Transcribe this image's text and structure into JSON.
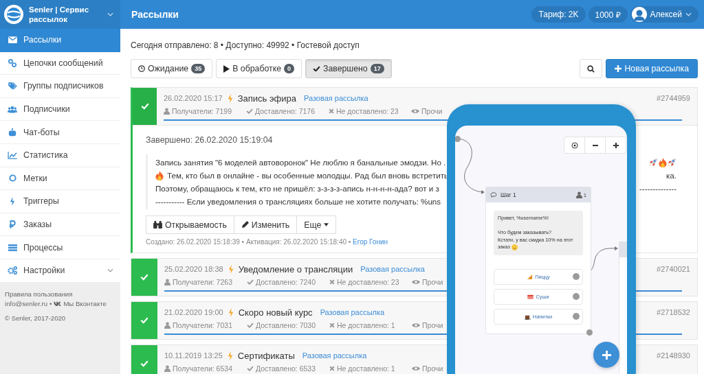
{
  "sidebar": {
    "brand": "Senler | Сервис рассылок",
    "items": [
      {
        "label": "Рассылки",
        "selected": true,
        "expandable": false
      },
      {
        "label": "Цепочки сообщений",
        "selected": false,
        "expandable": false
      },
      {
        "label": "Группы подписчиков",
        "selected": false,
        "expandable": false
      },
      {
        "label": "Подписчики",
        "selected": false,
        "expandable": false
      },
      {
        "label": "Чат-боты",
        "selected": false,
        "expandable": false
      },
      {
        "label": "Статистика",
        "selected": false,
        "expandable": false
      },
      {
        "label": "Метки",
        "selected": false,
        "expandable": false
      },
      {
        "label": "Триггеры",
        "selected": false,
        "expandable": false
      },
      {
        "label": "Заказы",
        "selected": false,
        "expandable": false
      },
      {
        "label": "Процессы",
        "selected": false,
        "expandable": false
      },
      {
        "label": "Настройки",
        "selected": false,
        "expandable": true
      }
    ],
    "footer": {
      "terms": "Правила пользования",
      "email": "info@senler.ru",
      "separator": "•",
      "vk": "Мы Вконтакте",
      "copyright": "© Senler, 2017-2020"
    }
  },
  "header": {
    "title": "Рассылки",
    "tariff": "Тариф: 2K",
    "balance": "1000 ₽",
    "user": "Алексей"
  },
  "summary": "Сегодня отправлено: 8 • Доступно: 49992 • Гостевой доступ",
  "tabs": [
    {
      "label": "Ожидание",
      "count": "35",
      "selected": false
    },
    {
      "label": "В обработке",
      "count": "0",
      "selected": false
    },
    {
      "label": "Завершено",
      "count": "17",
      "selected": true
    }
  ],
  "new_button": "Новая рассылка",
  "mailings": [
    {
      "date": "26.02.2020 15:17",
      "title": "Запись эфира",
      "type": "Разовая рассылка",
      "id": "#2744959",
      "recipients": "Получатели: 7199",
      "delivered": "Доставлено: 7176",
      "failed": "Не доставлено: 23",
      "read": "Прочи",
      "level": 1,
      "expanded": true,
      "details": {
        "completed": "Завершено: 26.02.2020 15:19:04",
        "message_lines": [
          {
            "left": "Запись занятия \"6 моделей автоворонок\" Не люблю я банальные эмодзи. Но ."
          },
          {
            "left": "Тем, кто был в онлайне - вы особенные молодцы. Рад был вновь встретить",
            "right": "ка."
          },
          {
            "left": "Поэтому, обращаюсь к тем, кто не пришёл: з-з-з-з-апись н-н-н-н-ада? вот и з",
            "right": "--------------"
          },
          {
            "left": "----------- Если уведомления о трансляциях больше не хотите получать: %uns"
          }
        ],
        "actions": [
          "Открываемость",
          "Изменить",
          "Еще"
        ],
        "meta": "Создано: 26.02.2020 15:18:39 • Активация: 26.02.2020 15:18:40 •",
        "author": "Егор Гонин"
      }
    },
    {
      "date": "25.02.2020 18:38",
      "title": "Уведомление о трансляции",
      "type": "Разовая рассылка",
      "id": "#2740021",
      "recipients": "Получатели: 7263",
      "delivered": "Доставлено: 7240",
      "failed": "Не доставлено: 23",
      "read": "Прочи",
      "level": 1,
      "expanded": false
    },
    {
      "date": "21.02.2020 19:00",
      "title": "Скоро новый курс",
      "type": "Разовая рассылка",
      "id": "#2718532",
      "recipients": "Получатели: 7031",
      "delivered": "Доставлено: 7030",
      "failed": "Не доставлено: 1",
      "read": "Прочи",
      "level": 1,
      "expanded": false
    },
    {
      "date": "10.11.2019 13:25",
      "title": "Сертификаты",
      "type": "Разовая рассылка",
      "id": "#2148930",
      "recipients": "Получатели: 6534",
      "delivered": "Доставлено: 6533",
      "failed": "Не доставлено: 1",
      "read": "Прочи",
      "expanded": false
    }
  ],
  "phone": {
    "step": "Шаг 1",
    "subscribers": "1",
    "message": "Привет, %username%!\n\nЧто будем заказывать?\nКстати, у вас скидка 10% на этот заказ",
    "options": [
      "Пиццу",
      "Суши",
      "Напитки"
    ]
  }
}
